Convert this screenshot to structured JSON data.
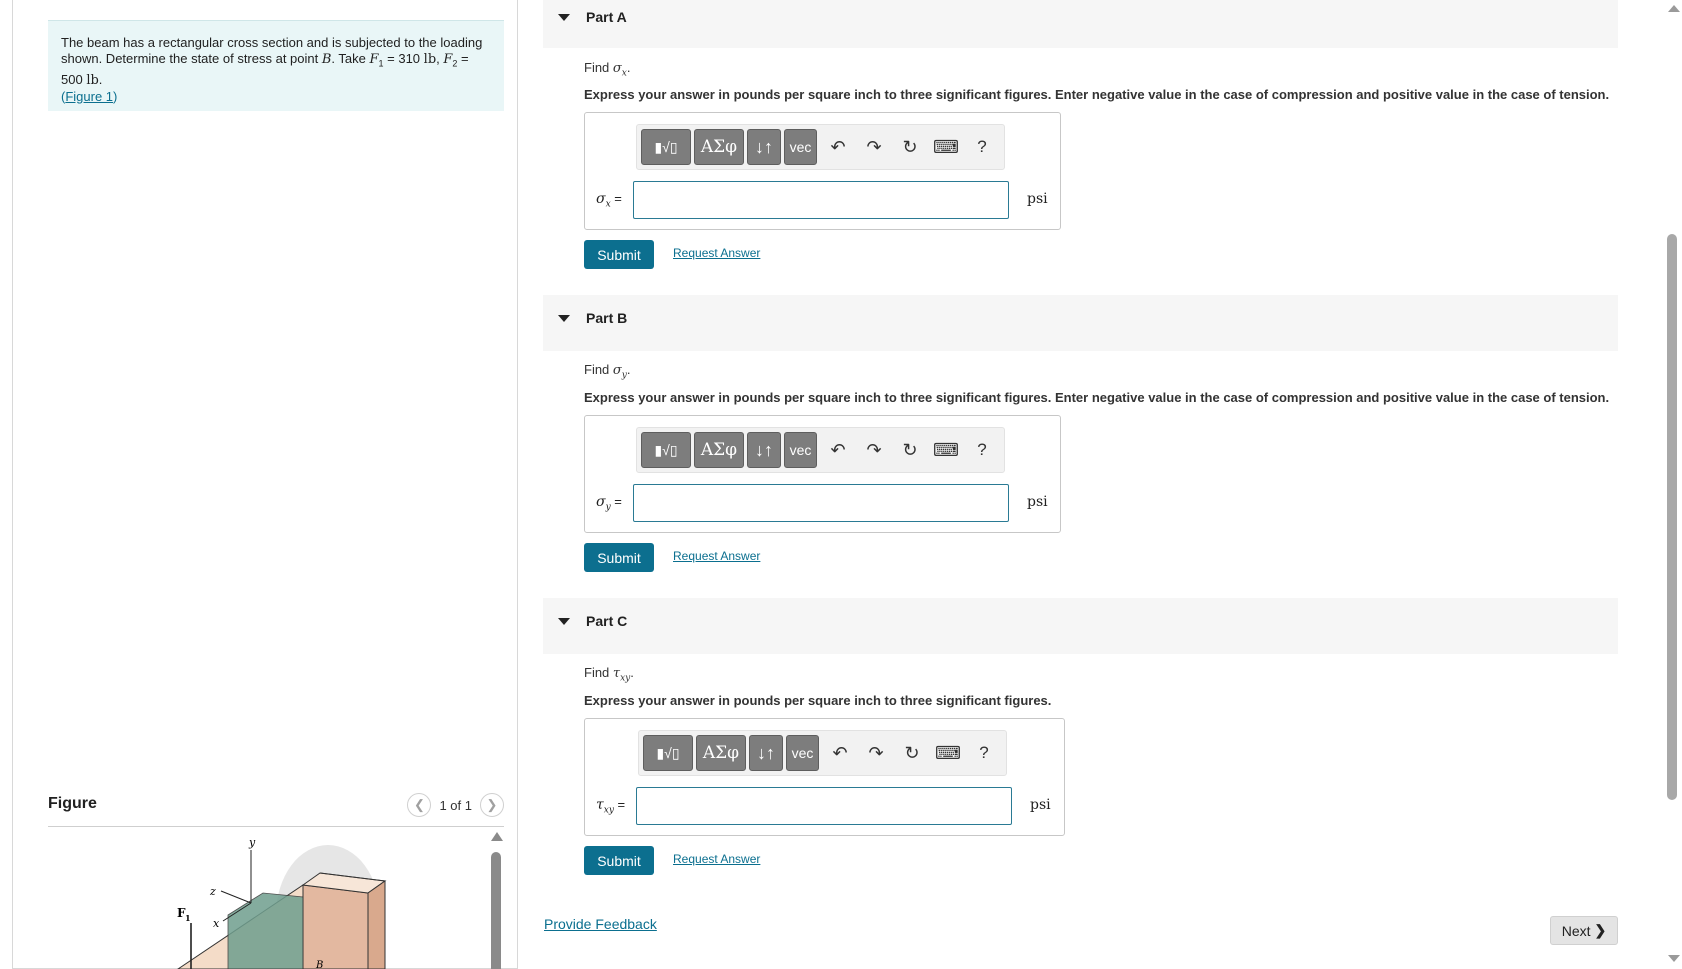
{
  "problem": {
    "text_intro": "The beam has a rectangular cross section and is subjected to the loading shown. Determine the state of stress at point ",
    "point": "B",
    "take": ". Take ",
    "f1_sym": "F",
    "f1_sub": "1",
    "f1_val": " = 310 ",
    "f1_unit": "lb",
    "sep": ", ",
    "f2_sym": "F",
    "f2_sub": "2",
    "f2_val": " = 500 ",
    "f2_unit": "lb",
    "end": ".",
    "figure_link": "Figure 1",
    "paren_open": "(",
    "paren_close": ")"
  },
  "figure": {
    "title": "Figure",
    "counter": "1 of 1",
    "labels": {
      "y": "y",
      "z": "z",
      "x": "x",
      "f1": "F",
      "f1_sub": "1",
      "b": "B"
    }
  },
  "toolbar": {
    "greek": "ΑΣφ",
    "arrows": "↓↑",
    "vec": "vec",
    "help": "?"
  },
  "parts": [
    {
      "label": "Part A",
      "find_prefix": "Find ",
      "find_sym": "σ",
      "find_sub": "x",
      "find_end": ".",
      "instruction": "Express your answer in pounds per square inch to three significant figures. Enter negative value in the case of compression and positive value in the case of tension.",
      "var_sym": "σ",
      "var_sub": "x",
      "var_eq": " =",
      "unit": "psi",
      "submit": "Submit",
      "request": "Request Answer"
    },
    {
      "label": "Part B",
      "find_prefix": "Find ",
      "find_sym": "σ",
      "find_sub": "y",
      "find_end": ".",
      "instruction": "Express your answer in pounds per square inch to three significant figures. Enter negative value in the case of compression and positive value in the case of tension.",
      "var_sym": "σ",
      "var_sub": "y",
      "var_eq": " =",
      "unit": "psi",
      "submit": "Submit",
      "request": "Request Answer"
    },
    {
      "label": "Part C",
      "find_prefix": "Find ",
      "find_sym": "τ",
      "find_sub": "xy",
      "find_end": ".",
      "instruction": "Express your answer in pounds per square inch to three significant figures.",
      "var_sym": "τ",
      "var_sub": "xy",
      "var_eq": " =",
      "unit": "psi",
      "submit": "Submit",
      "request": "Request Answer"
    }
  ],
  "footer": {
    "feedback": "Provide Feedback",
    "next": "Next"
  },
  "colors": {
    "accent": "#0c6f8f",
    "problem_bg": "#e9f6f7",
    "part_header_bg": "#f6f6f6"
  }
}
